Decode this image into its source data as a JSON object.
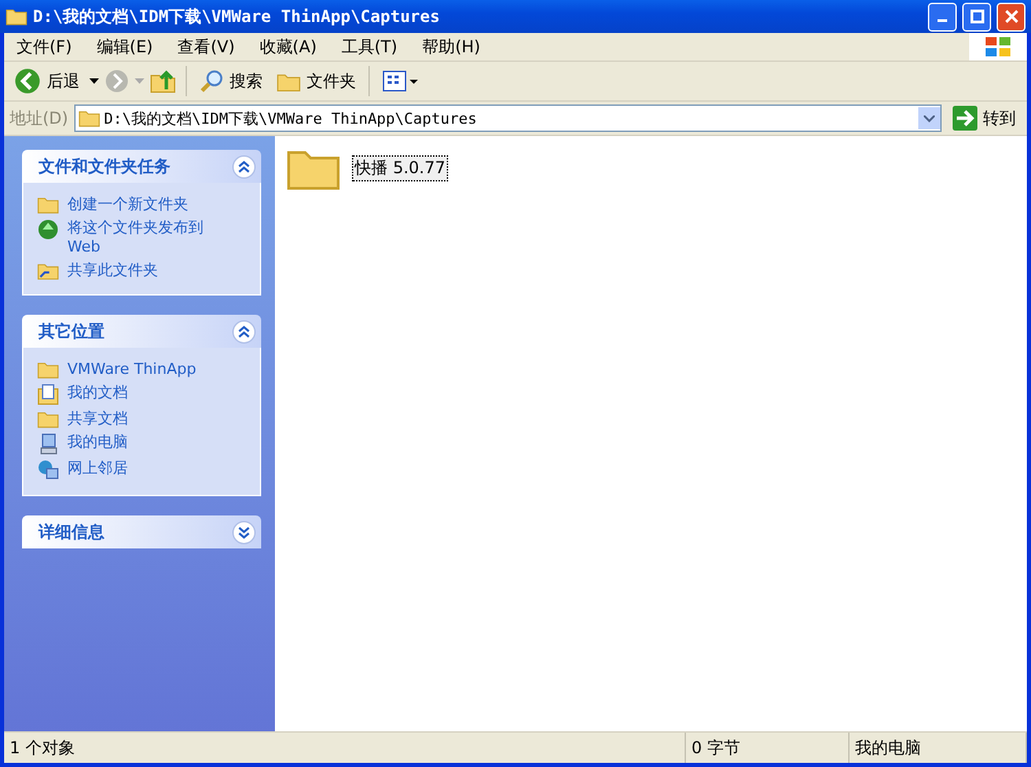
{
  "window": {
    "title": "D:\\我的文档\\IDM下载\\VMWare ThinApp\\Captures"
  },
  "menu": [
    "文件(F)",
    "编辑(E)",
    "查看(V)",
    "收藏(A)",
    "工具(T)",
    "帮助(H)"
  ],
  "toolbar": {
    "back": "后退",
    "search": "搜索",
    "folders": "文件夹"
  },
  "address": {
    "label": "地址(D)",
    "value": "D:\\我的文档\\IDM下载\\VMWare ThinApp\\Captures",
    "go": "转到"
  },
  "task_panels": [
    {
      "title": "文件和文件夹任务",
      "expanded": true,
      "items": [
        {
          "label": "创建一个新文件夹",
          "kind": "new-folder"
        },
        {
          "label": "将这个文件夹发布到Web",
          "kind": "globe"
        },
        {
          "label": "共享此文件夹",
          "kind": "share"
        }
      ]
    },
    {
      "title": "其它位置",
      "expanded": true,
      "items": [
        {
          "label": "VMWare ThinApp",
          "kind": "folder"
        },
        {
          "label": "我的文档",
          "kind": "documents"
        },
        {
          "label": "共享文档",
          "kind": "folder"
        },
        {
          "label": "我的电脑",
          "kind": "computer"
        },
        {
          "label": "网上邻居",
          "kind": "network"
        }
      ]
    },
    {
      "title": "详细信息",
      "expanded": false
    }
  ],
  "files": [
    {
      "name": "快播 5.0.77",
      "selected": true
    }
  ],
  "status_bar": [
    "1 个对象",
    "0 字节",
    "我的电脑"
  ]
}
